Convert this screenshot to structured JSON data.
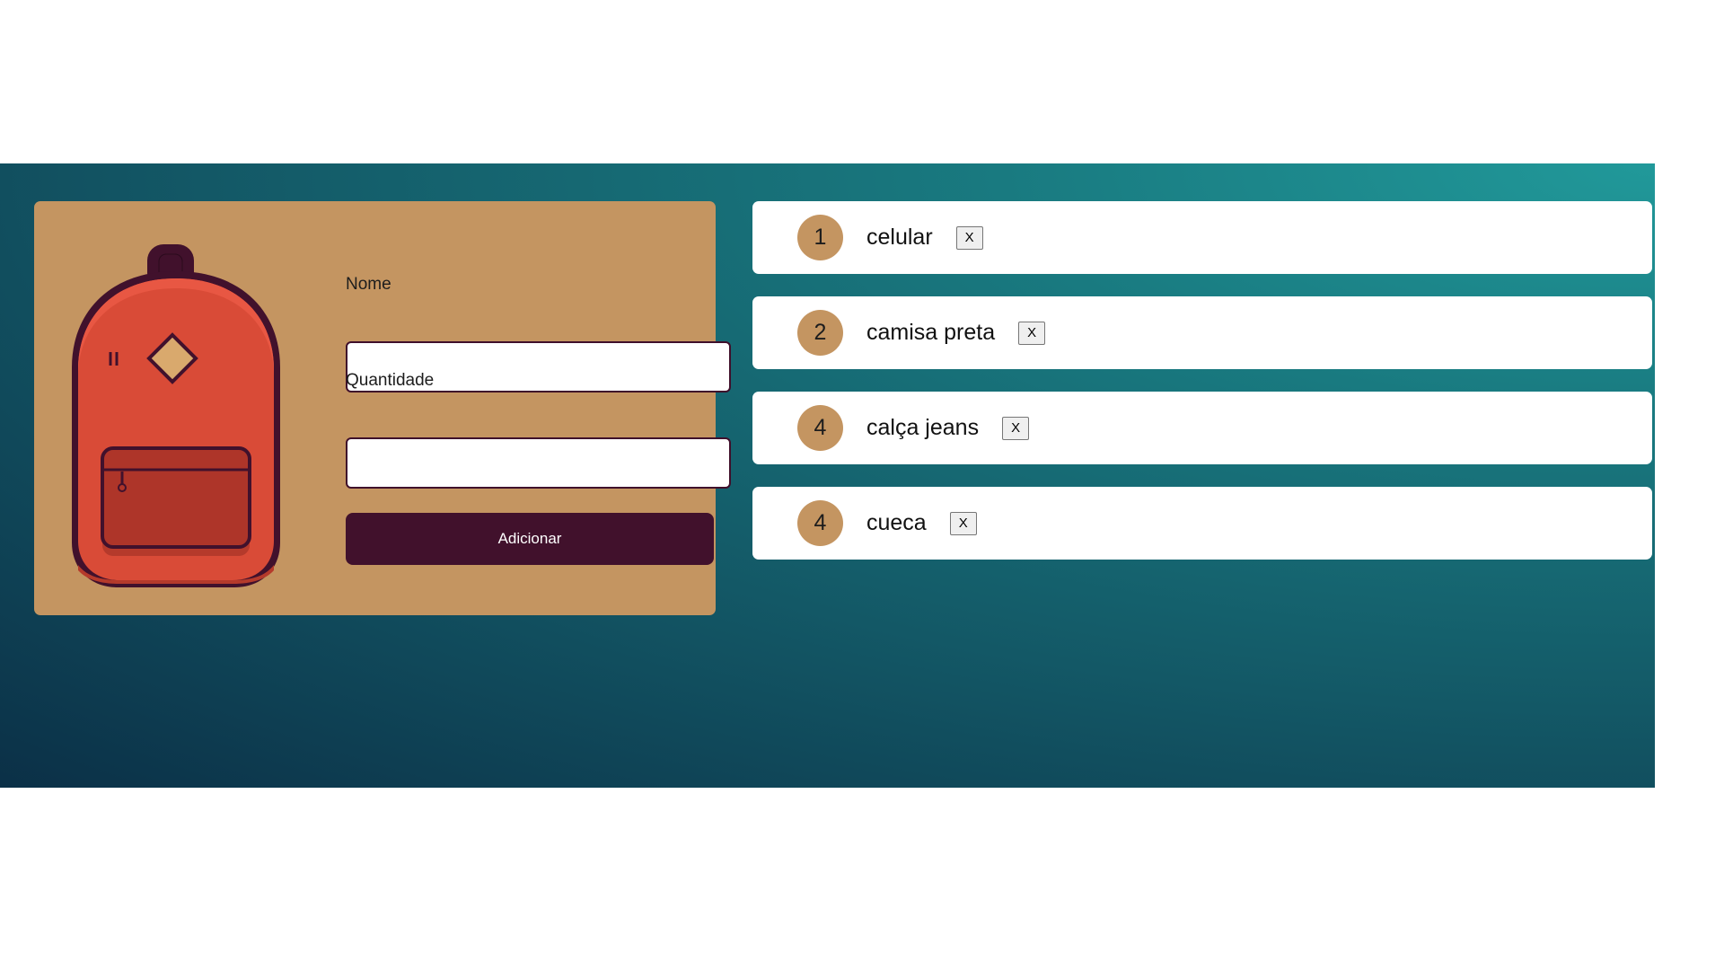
{
  "form": {
    "name_label": "Nome",
    "name_value": "",
    "quantity_label": "Quantidade",
    "quantity_value": "",
    "submit_label": "Adicionar"
  },
  "items": [
    {
      "quantity": "1",
      "name": "celular",
      "remove_label": "X"
    },
    {
      "quantity": "2",
      "name": "camisa preta",
      "remove_label": "X"
    },
    {
      "quantity": "4",
      "name": "calça jeans",
      "remove_label": "X"
    },
    {
      "quantity": "4",
      "name": "cueca",
      "remove_label": "X"
    }
  ],
  "colors": {
    "card": "#c49561",
    "button": "#41112c",
    "gradient_light": "#21999a",
    "gradient_dark": "#0b3047"
  },
  "icons": [
    "backpack-icon"
  ]
}
